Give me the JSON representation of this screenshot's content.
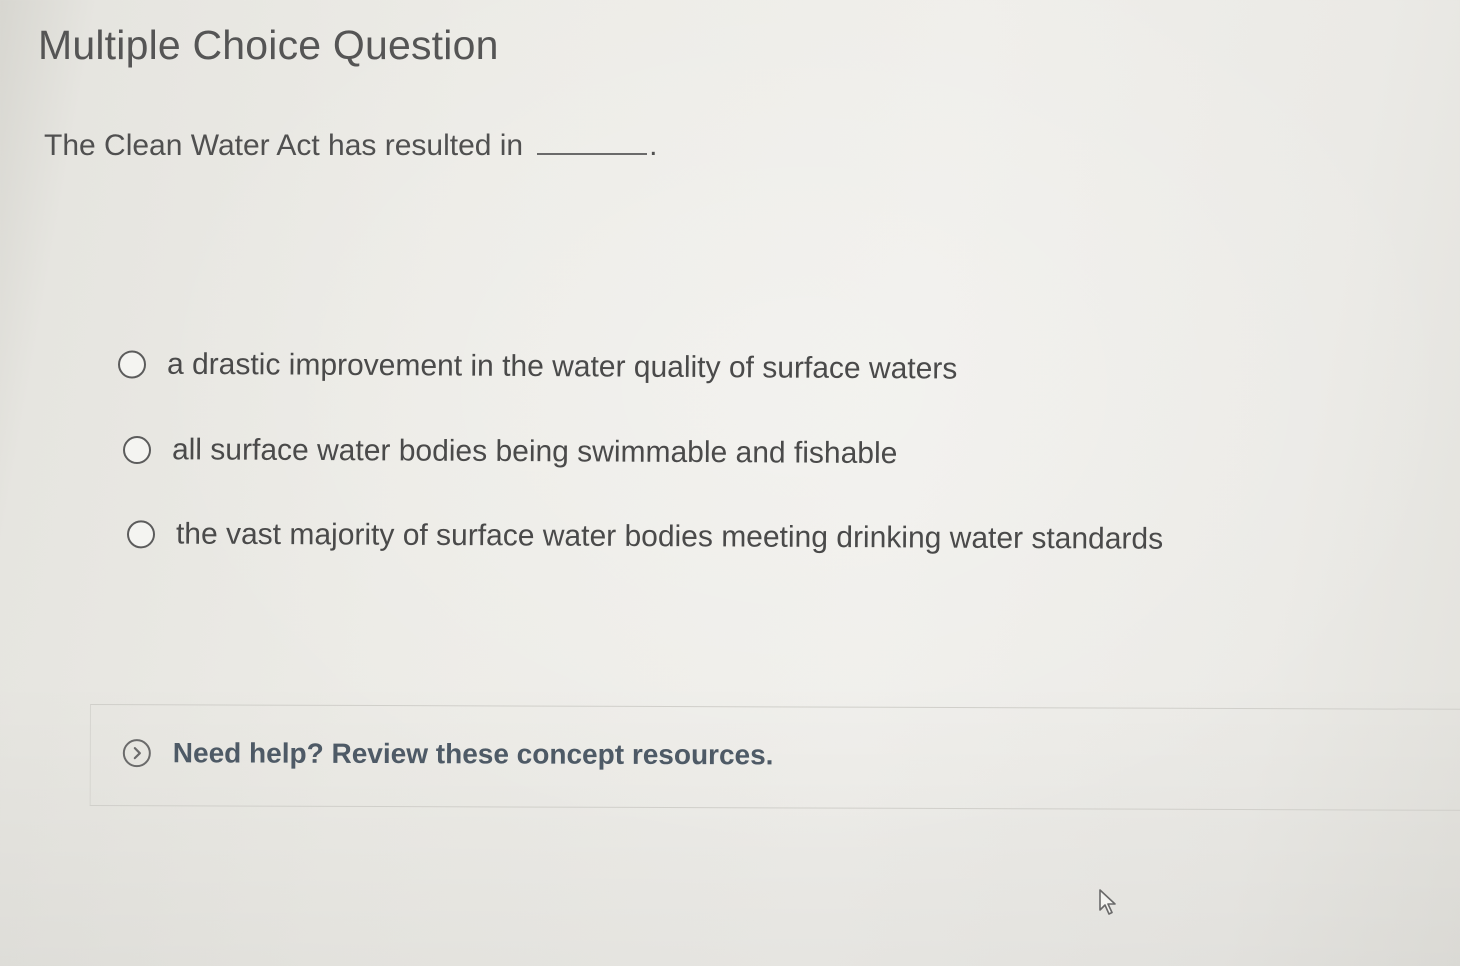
{
  "question": {
    "header": "Multiple Choice Question",
    "prompt": "The Clean Water Act has resulted in",
    "prompt_end": "."
  },
  "options": [
    {
      "label": "a drastic improvement in the water quality of surface waters",
      "selected": false
    },
    {
      "label": "all surface water bodies being swimmable and fishable",
      "selected": false
    },
    {
      "label": "the vast majority of surface water bodies meeting drinking water standards",
      "selected": false
    }
  ],
  "help": {
    "label": "Need help? Review these concept resources.",
    "icon": "chevron-right-circle-icon"
  },
  "colors": {
    "text": "#4b4b4b",
    "help_link": "#4e5a66",
    "background": "#ecebe6"
  }
}
